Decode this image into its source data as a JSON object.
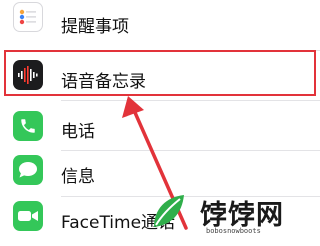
{
  "settings_list": {
    "items": [
      {
        "label": "提醒事项",
        "icon": "reminders-icon"
      },
      {
        "label": "语音备忘录",
        "icon": "voice-memos-icon"
      },
      {
        "label": "电话",
        "icon": "phone-icon"
      },
      {
        "label": "信息",
        "icon": "messages-icon"
      },
      {
        "label": "FaceTime通话",
        "icon": "facetime-icon"
      }
    ]
  },
  "annotation": {
    "color": "#e2333a"
  },
  "watermark": {
    "text": "饽饽网",
    "url": "bobosnowboots"
  },
  "colors": {
    "phone_green": "#34c759",
    "voice_memo_bg": "#1c1c1e"
  }
}
